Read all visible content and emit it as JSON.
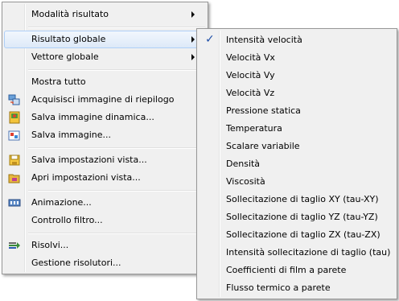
{
  "main_menu": {
    "items": [
      {
        "label": "Modalità risultato",
        "submenu": true
      },
      {
        "label": "Risultato globale",
        "submenu": true,
        "highlighted": true
      },
      {
        "label": "Vettore globale",
        "submenu": true
      },
      {
        "label": "Mostra tutto"
      },
      {
        "label": "Acquisisci immagine di riepilogo",
        "icon": "capture-summary-icon"
      },
      {
        "label": "Salva immagine dinamica...",
        "icon": "save-dynamic-image-icon"
      },
      {
        "label": "Salva immagine...",
        "icon": "save-image-icon"
      },
      {
        "label": "Salva impostazioni vista...",
        "icon": "save-view-settings-icon"
      },
      {
        "label": "Apri impostazioni vista...",
        "icon": "open-view-settings-icon"
      },
      {
        "label": "Animazione...",
        "icon": "animation-icon"
      },
      {
        "label": "Controllo filtro..."
      },
      {
        "label": "Risolvi...",
        "icon": "solve-icon"
      },
      {
        "label": "Gestione risolutori..."
      }
    ]
  },
  "sub_menu": {
    "items": [
      {
        "label": "Intensità velocità",
        "checked": true
      },
      {
        "label": "Velocità Vx"
      },
      {
        "label": "Velocità Vy"
      },
      {
        "label": "Velocità Vz"
      },
      {
        "label": "Pressione statica"
      },
      {
        "label": "Temperatura"
      },
      {
        "label": "Scalare variabile"
      },
      {
        "label": "Densità"
      },
      {
        "label": "Viscosità"
      },
      {
        "label": "Sollecitazione di taglio XY (tau-XY)"
      },
      {
        "label": "Sollecitazione di taglio YZ (tau-YZ)"
      },
      {
        "label": "Sollecitazione di taglio ZX (tau-ZX)"
      },
      {
        "label": "Intensità sollecitazione di taglio (tau)"
      },
      {
        "label": "Coefficienti di film a parete"
      },
      {
        "label": "Flusso termico a parete"
      }
    ]
  },
  "colors": {
    "menu_bg": "#f0f0f0",
    "highlight_border": "#aecff7",
    "check": "#1e4fa8"
  }
}
